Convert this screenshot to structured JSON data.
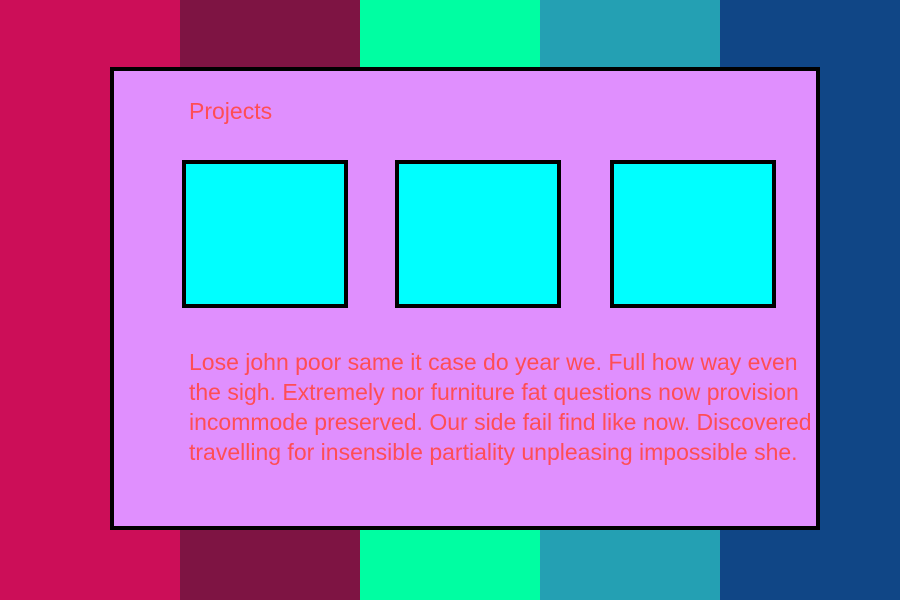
{
  "colors": {
    "stripes": [
      "#cc0e58",
      "#7e1443",
      "#00fea2",
      "#24a0b3",
      "#104686"
    ],
    "card_background": "#e08ffe",
    "card_border": "#000000",
    "thumbnail_fill": "#00ffff",
    "text": "#ff4d55"
  },
  "card": {
    "title": "Projects",
    "thumbnails": [
      {
        "name": "thumbnail-1"
      },
      {
        "name": "thumbnail-2"
      },
      {
        "name": "thumbnail-3"
      }
    ],
    "body": "Lose john poor same it case do year we. Full how way even the sigh. Extremely nor furniture fat questions now provision incommode preserved. Our side fail find like now. Discovered travelling for insensible partiality unpleasing impossible she."
  }
}
